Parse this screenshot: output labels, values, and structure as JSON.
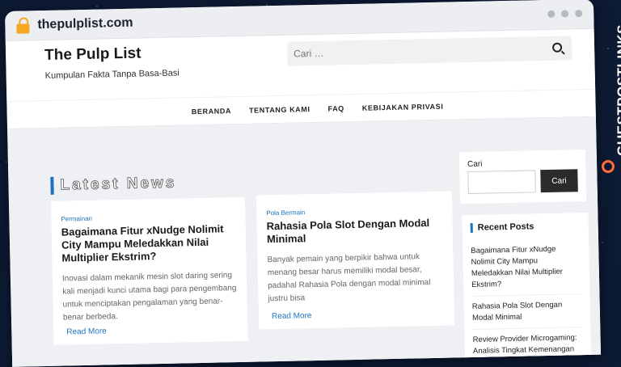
{
  "browser": {
    "url": "thepulplist.com"
  },
  "site": {
    "title": "The Pulp List",
    "tagline": "Kumpulan Fakta Tanpa Basa-Basi"
  },
  "header_search": {
    "placeholder": "Cari …"
  },
  "nav": [
    "BERANDA",
    "TENTANG KAMI",
    "FAQ",
    "KEBIJAKAN PRIVASI"
  ],
  "section_title": "Latest News",
  "posts": [
    {
      "category": "Permainan",
      "title": "Bagaimana Fitur xNudge Nolimit City Mampu Meledakkan Nilai Multiplier Ekstrim?",
      "excerpt": "Inovasi dalam mekanik mesin slot daring sering kali menjadi kunci utama bagi para pengembang untuk menciptakan pengalaman yang benar-benar berbeda.",
      "read_more": "Read More"
    },
    {
      "category": "Pola Bermain",
      "title": "Rahasia Pola Slot Dengan Modal Minimal",
      "excerpt": "Banyak pemain yang berpikir bahwa untuk menang besar harus memiliki modal besar, padahal Rahasia Pola dengan modal minimal justru bisa",
      "read_more": "Read More"
    }
  ],
  "sidebar": {
    "search_label": "Cari",
    "search_button": "Cari",
    "recent_title": "Recent Posts",
    "recent": [
      "Bagaimana Fitur xNudge Nolimit City Mampu Meledakkan Nilai Multiplier Ekstrim?",
      "Rahasia Pola Slot Dengan Modal Minimal",
      "Review Provider Microgaming: Analisis Tingkat Kemenangan"
    ]
  },
  "brand": {
    "text": "GUESTPOSTLINKS"
  },
  "colors": {
    "accent": "#1e73be",
    "brand": "#ff6a3d",
    "lock": "#f5a623"
  }
}
